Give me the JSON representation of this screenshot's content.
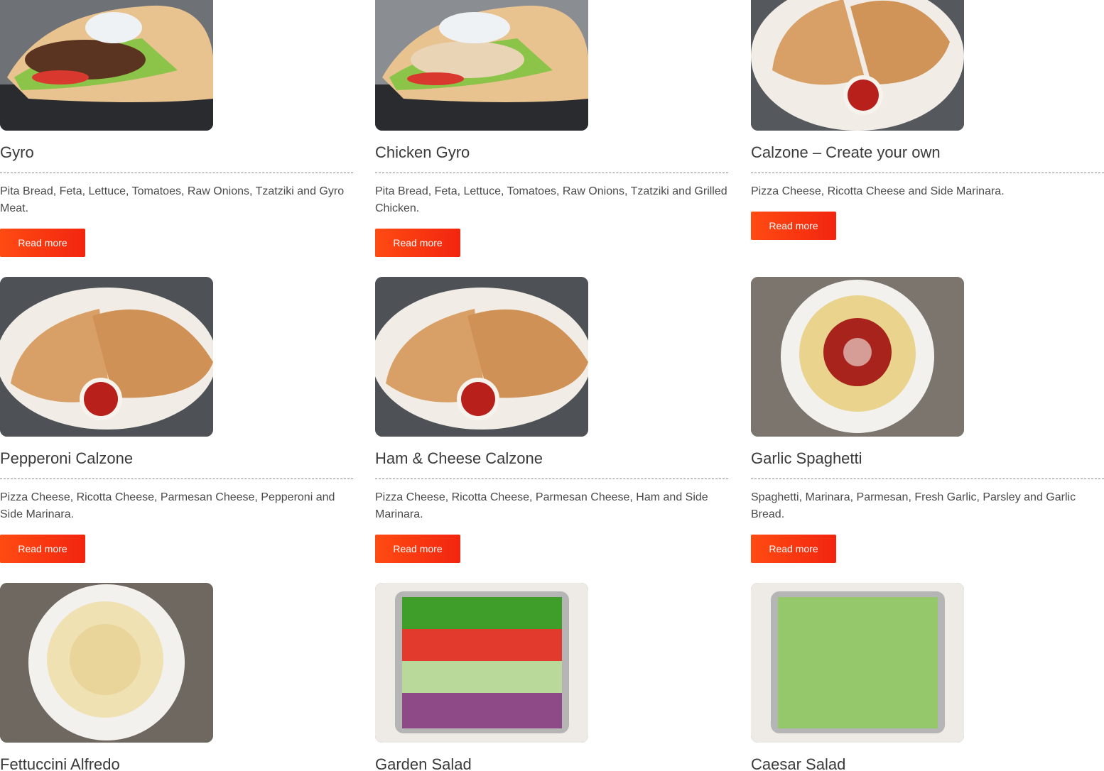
{
  "menu": {
    "items": [
      {
        "title": "Gyro",
        "description": "Pita Bread, Feta, Lettuce, Tomatoes, Raw Onions, Tzatziki and Gyro Meat.",
        "button": "Read more",
        "image": "gyro-photo"
      },
      {
        "title": "Chicken Gyro",
        "description": "Pita Bread, Feta, Lettuce, Tomatoes, Raw Onions, Tzatziki and Grilled Chicken.",
        "button": "Read more",
        "image": "chicken-gyro-photo"
      },
      {
        "title": "Calzone – Create your own",
        "description": "Pizza Cheese, Ricotta Cheese and Side Marinara.",
        "button": "Read more",
        "image": "calzone-photo"
      },
      {
        "title": "Pepperoni Calzone",
        "description": "Pizza Cheese, Ricotta Cheese, Parmesan Cheese, Pepperoni and Side Marinara.",
        "button": "Read more",
        "image": "pepperoni-calzone-photo"
      },
      {
        "title": "Ham & Cheese Calzone",
        "description": "Pizza Cheese, Ricotta Cheese, Parmesan Cheese, Ham and Side Marinara.",
        "button": "Read more",
        "image": "ham-cheese-calzone-photo"
      },
      {
        "title": "Garlic Spaghetti",
        "description": "Spaghetti, Marinara, Parmesan, Fresh Garlic, Parsley and Garlic Bread.",
        "button": "Read more",
        "image": "spaghetti-photo"
      },
      {
        "title": "Fettuccini Alfredo",
        "image": "fettuccini-photo"
      },
      {
        "title": "Garden Salad",
        "image": "garden-salad-photo"
      },
      {
        "title": "Caesar Salad",
        "image": "caesar-salad-photo"
      }
    ]
  },
  "colors": {
    "button_start": "#ff4b12",
    "button_end": "#f2250f",
    "title": "#3a3a3a",
    "text": "#4a4a4a"
  }
}
